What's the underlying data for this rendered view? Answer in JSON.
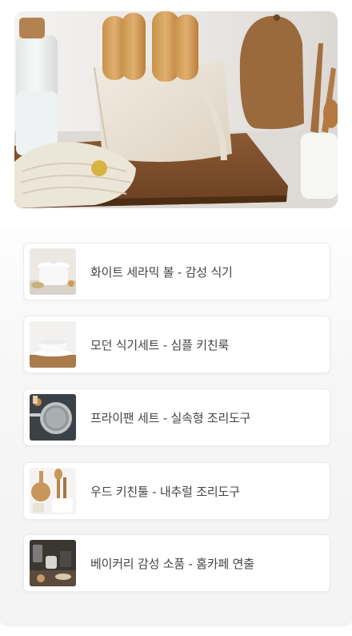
{
  "hero": {
    "icon": "kitchen-bread-bag-photo"
  },
  "products": [
    {
      "title": "화이트 세라믹 볼 - 감성 식기",
      "thumb_icon": "white-ceramic-pot-photo"
    },
    {
      "title": "모던 식기세트 - 심플 키친룩",
      "thumb_icon": "modern-tableware-photo"
    },
    {
      "title": "프라이팬 세트 - 실속형 조리도구",
      "thumb_icon": "frying-pan-photo"
    },
    {
      "title": "우드 키친툴 - 내추럴 조리도구",
      "thumb_icon": "wood-kitchen-tools-photo"
    },
    {
      "title": "베이커리 감성 소품 - 홈카페 연출",
      "thumb_icon": "bakery-props-photo"
    }
  ]
}
